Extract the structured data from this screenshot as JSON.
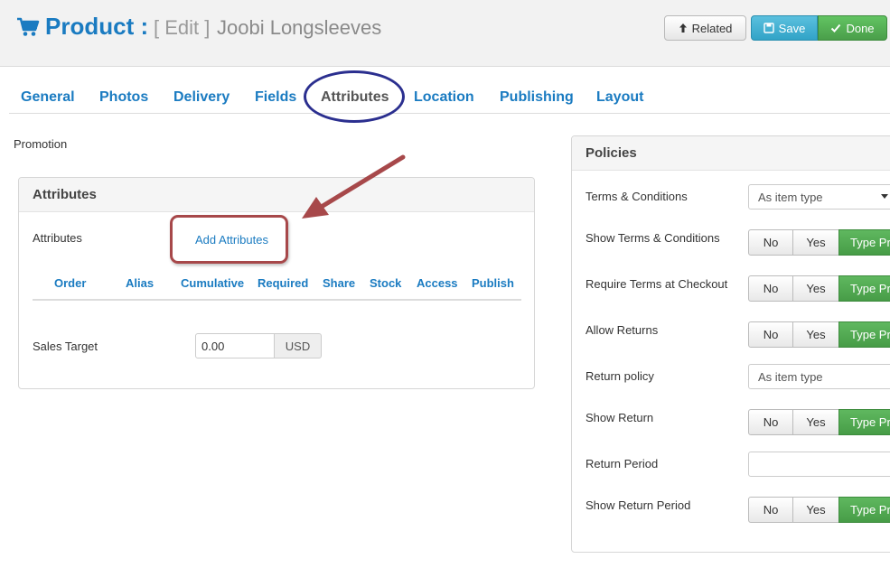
{
  "header": {
    "icon": "shopping-cart-icon",
    "title": "Product :",
    "edit_label": "[ Edit ]",
    "product_name": "Joobi Longsleeves",
    "related_label": "Related",
    "save_label": "Save",
    "done_label": "Done"
  },
  "tabs": [
    "General",
    "Photos",
    "Delivery",
    "Fields",
    "Attributes",
    "Location",
    "Publishing",
    "Layout"
  ],
  "active_tab": "Attributes",
  "promotion_label": "Promotion",
  "attributes_panel": {
    "title": "Attributes",
    "attributes_label": "Attributes",
    "add_link": "Add Attributes",
    "columns": [
      "Order",
      "Alias",
      "Cumulative",
      "Required",
      "Share",
      "Stock",
      "Access",
      "Publish"
    ],
    "sales_target_label": "Sales Target",
    "sales_target_value": "0.00",
    "currency": "USD"
  },
  "policies_panel": {
    "title": "Policies",
    "terms_label": "Terms & Conditions",
    "terms_value": "As item type",
    "show_terms_label": "Show Terms & Conditions",
    "require_terms_label": "Require Terms at Checkout",
    "allow_returns_label": "Allow Returns",
    "return_policy_label": "Return policy",
    "return_policy_value": "As item type",
    "show_return_label": "Show Return",
    "return_period_label": "Return Period",
    "show_return_period_label": "Show Return Period",
    "toggle_no": "No",
    "toggle_yes": "Yes",
    "toggle_type": "Type Pr"
  },
  "colors": {
    "link_blue": "#1a7bc1",
    "save_blue": "#5bc0de",
    "done_green": "#5cb85c",
    "annotation_red": "#a7484a",
    "annotation_navy": "#2b2f8f"
  }
}
